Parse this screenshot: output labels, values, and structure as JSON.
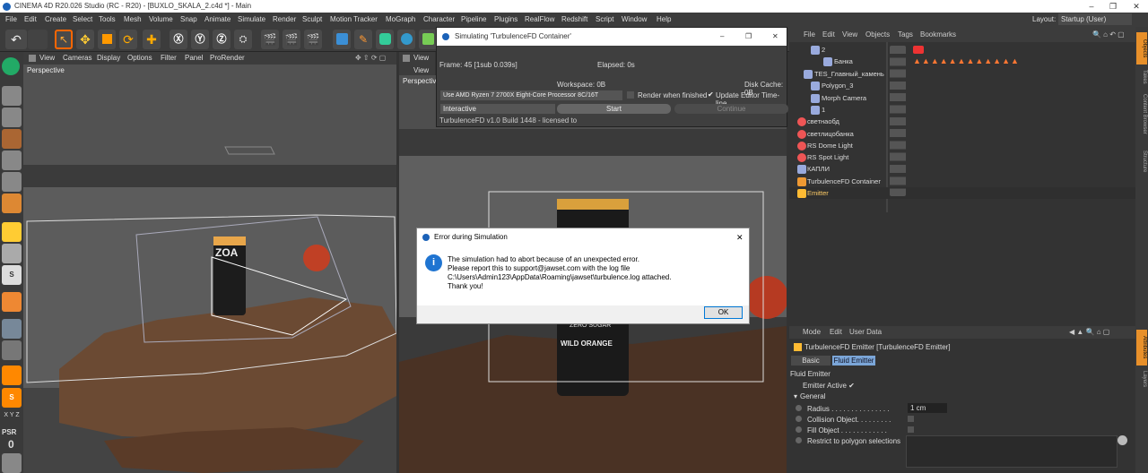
{
  "window": {
    "title": "CINEMA 4D R20.026 Studio (RC - R20) - [BUXLO_SKALA_2.c4d *] - Main",
    "controls": [
      "–",
      "❐",
      "✕"
    ]
  },
  "menubar": {
    "items": [
      "File",
      "Edit",
      "Create",
      "Select",
      "Tools",
      "Mesh",
      "Volume",
      "Snap",
      "Animate",
      "Simulate",
      "Render",
      "Sculpt",
      "Motion Tracker",
      "MoGraph",
      "Character",
      "Pipeline",
      "Plugins",
      "RealFlow",
      "Redshift",
      "Script",
      "Window",
      "Help"
    ],
    "layout_label": "Layout:",
    "layout_value": "Startup (User)"
  },
  "viewport_left": {
    "menu": [
      "View",
      "Cameras",
      "Display",
      "Options",
      "Filter",
      "Panel",
      "ProRender"
    ],
    "label": "Perspective"
  },
  "viewport_right": {
    "menu": [
      "View"
    ],
    "label": "Perspective"
  },
  "sim_window": {
    "title": "Simulating 'TurbulenceFD Container'",
    "frame": "Frame: 45 [1sub 0.039s]",
    "elapsed": "Elapsed: 0s",
    "workspace": "Workspace: 0B",
    "disk_cache": "Disk Cache: 0B",
    "device": "Use  AMD Ryzen 7 2700X Eight-Core Processor 8C/16T",
    "render_when_finished": "Render when finished",
    "update_editor": "Update Editor Time-line",
    "mode": "Interactive",
    "start": "Start",
    "continue": "Continue",
    "build": "TurbulenceFD v1.0 Build 1448 - licensed to"
  },
  "error_dialog": {
    "title": "Error during Simulation",
    "line1": "The simulation had to abort because of an unexpected error.",
    "line2": "Please report this to support@jawset.com with the log file",
    "line3": "C:\\Users\\Admin123\\AppData\\Roaming\\jawset\\turbulence.log attached.",
    "line4": "Thank you!",
    "ok": "OK"
  },
  "object_manager": {
    "menu": [
      "File",
      "Edit",
      "View",
      "Objects",
      "Tags",
      "Bookmarks"
    ],
    "rows": [
      {
        "name": "2",
        "color": "#9ad"
      },
      {
        "name": "Банка",
        "color": "#9ad"
      },
      {
        "name": "TES_Главный_камень",
        "color": "#9ad"
      },
      {
        "name": "Polygon_3",
        "color": "#9ad"
      },
      {
        "name": "Morph Camera",
        "color": "#9ad"
      },
      {
        "name": "1",
        "color": "#9ad"
      },
      {
        "name": "светнаобд",
        "color": "#e55"
      },
      {
        "name": "светлицобанка",
        "color": "#e55"
      },
      {
        "name": "RS Dome Light",
        "color": "#e55"
      },
      {
        "name": "RS Spot Light",
        "color": "#e55"
      },
      {
        "name": "КАПЛИ",
        "color": "#9ad"
      },
      {
        "name": "TurbulenceFD Container",
        "color": "#e93"
      },
      {
        "name": "Emitter",
        "color": "#fb3"
      }
    ]
  },
  "attribute_manager": {
    "menu": [
      "Mode",
      "Edit",
      "User Data"
    ],
    "object_title": "TurbulenceFD Emitter [TurbulenceFD Emitter]",
    "tabs": [
      "Basic",
      "Fluid Emitter"
    ],
    "section": "Fluid Emitter",
    "emitter_active": "Emitter Active ✔",
    "group": "General",
    "radius_label": "Radius . . . . . . . . . . . . . . .",
    "radius_value": "1 cm",
    "collision_label": "Collision Object. . . . . . . . .",
    "fill_label": "Fill Object . . . . . . . . . . . .",
    "restrict_label": "Restrict to polygon selections"
  },
  "right_tabs": [
    "Objects",
    "Takes",
    "Content Browser",
    "Structure"
  ],
  "right_tabs2": [
    "Attributes",
    "Layers"
  ],
  "left_toolbar_labels": {
    "xyz": "X Y Z",
    "psr": "PSR",
    "zero": "0"
  },
  "can_label": "ZOA",
  "can_label2": "WILD ORANGE",
  "can_label3": "ZERO SUGAR"
}
